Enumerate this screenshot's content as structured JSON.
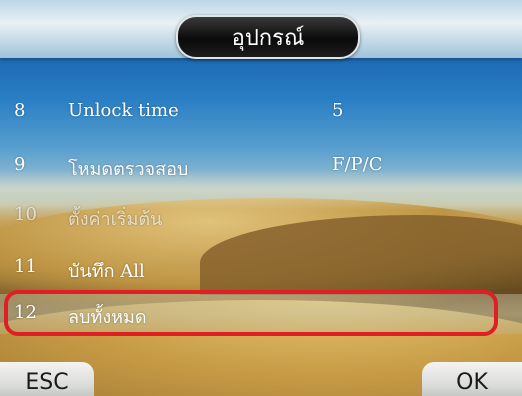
{
  "header": {
    "title": "อุปกรณ์"
  },
  "menu": {
    "items": [
      {
        "num": "8",
        "label": "Unlock time",
        "value": "5"
      },
      {
        "num": "9",
        "label": "โหมดตรวจสอบ",
        "value": "F/P/C"
      },
      {
        "num": "10",
        "label": "ตั้งค่าเริ่มต้น",
        "value": ""
      },
      {
        "num": "11",
        "label": "บันทึก All",
        "value": ""
      },
      {
        "num": "12",
        "label": "ลบทั้งหมด",
        "value": ""
      }
    ],
    "selected_index": 4
  },
  "footer": {
    "esc_label": "ESC",
    "ok_label": "OK"
  },
  "colors": {
    "highlight_ring": "#e01f25",
    "title_pill": "#0a0a0a"
  }
}
